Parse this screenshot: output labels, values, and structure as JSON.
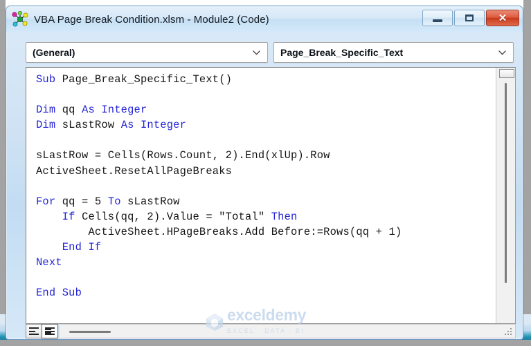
{
  "window": {
    "title": "VBA Page Break Condition.xlsm - Module2 (Code)",
    "icon": "vba-module-icon",
    "controls": {
      "minimize_label": "–",
      "maximize_label": "□",
      "close_label": "✕"
    }
  },
  "toolbar": {
    "object_combo": {
      "value": "(General)",
      "arrow_icon": "chevron-down-icon"
    },
    "procedure_combo": {
      "value": "Page_Break_Specific_Text",
      "arrow_icon": "chevron-down-icon"
    }
  },
  "code": {
    "lines": [
      [
        {
          "t": "Sub ",
          "k": true
        },
        {
          "t": "Page_Break_Specific_Text()",
          "k": false
        }
      ],
      [],
      [
        {
          "t": "Dim ",
          "k": true
        },
        {
          "t": "qq ",
          "k": false
        },
        {
          "t": "As Integer",
          "k": true
        }
      ],
      [
        {
          "t": "Dim ",
          "k": true
        },
        {
          "t": "sLastRow ",
          "k": false
        },
        {
          "t": "As Integer",
          "k": true
        }
      ],
      [],
      [
        {
          "t": "sLastRow = Cells(Rows.Count, 2).End(xlUp).Row",
          "k": false
        }
      ],
      [
        {
          "t": "ActiveSheet.ResetAllPageBreaks",
          "k": false
        }
      ],
      [],
      [
        {
          "t": "For ",
          "k": true
        },
        {
          "t": "qq = 5 ",
          "k": false
        },
        {
          "t": "To ",
          "k": true
        },
        {
          "t": "sLastRow",
          "k": false
        }
      ],
      [
        {
          "t": "    ",
          "k": false
        },
        {
          "t": "If ",
          "k": true
        },
        {
          "t": "Cells(qq, 2).Value = \"Total\" ",
          "k": false
        },
        {
          "t": "Then",
          "k": true
        }
      ],
      [
        {
          "t": "        ActiveSheet.HPageBreaks.Add Before:=Rows(qq + 1)",
          "k": false
        }
      ],
      [
        {
          "t": "    ",
          "k": false
        },
        {
          "t": "End If",
          "k": true
        }
      ],
      [
        {
          "t": "Next",
          "k": true
        }
      ],
      [],
      [
        {
          "t": "End Sub",
          "k": true
        }
      ]
    ]
  },
  "status_bar": {
    "procedure_view_label": "Procedure View",
    "full_module_view_label": "Full Module View"
  },
  "watermark": {
    "brand": "exceldemy",
    "tagline": "EXCEL - DATA - BI"
  },
  "colors": {
    "keyword": "#2525d6",
    "code_text": "#151515",
    "title_bar_start": "#e4f0fb",
    "title_bar_end": "#d4e9fa",
    "close_button": "#c9391c",
    "watermark": "#b9cfe8"
  }
}
